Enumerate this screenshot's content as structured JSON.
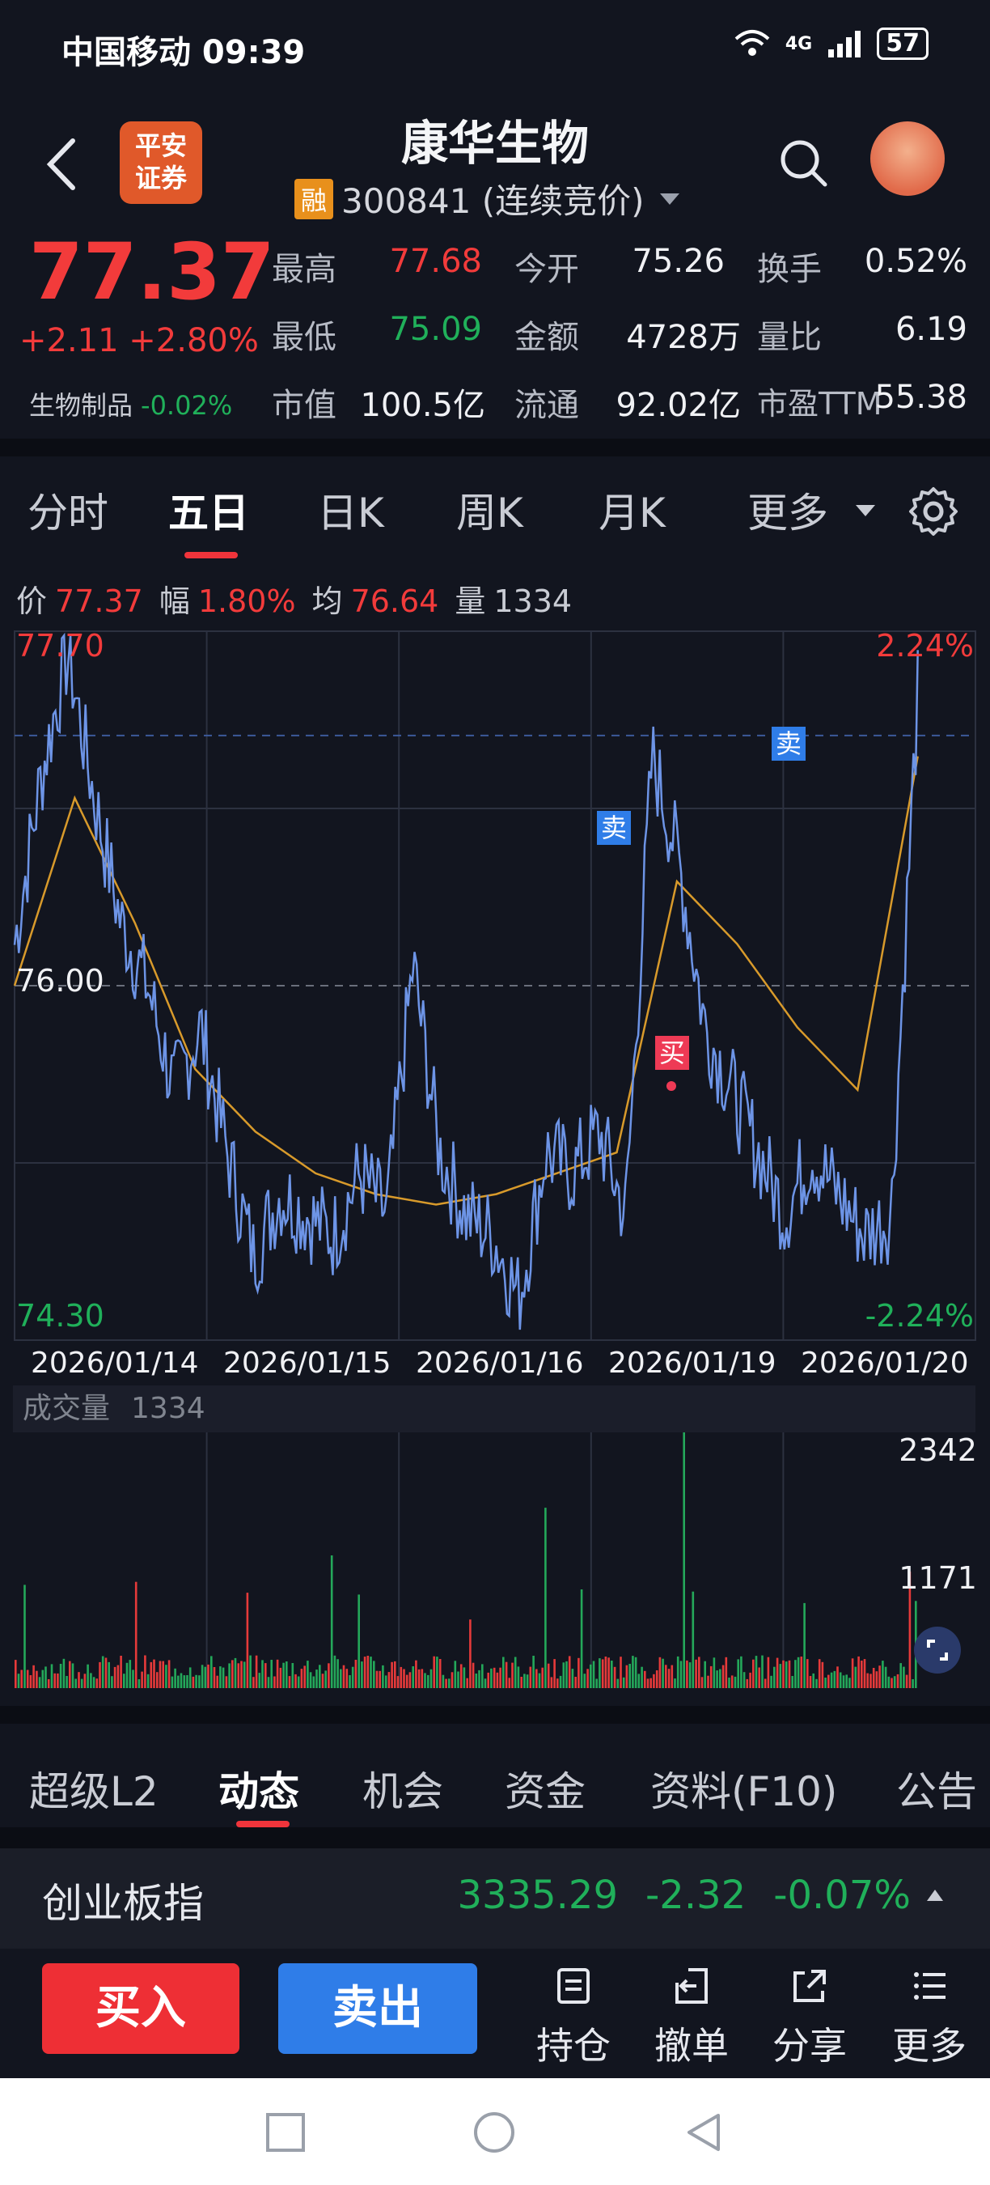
{
  "status": {
    "carrier_time": "中国移动 09:39",
    "net_badge": "4G",
    "battery": "57"
  },
  "header": {
    "logo_text": "平安\n证券",
    "name": "康华生物",
    "rong": "融",
    "code": "300841 (连续竞价)"
  },
  "quote": {
    "price": "77.37",
    "change": "+2.11  +2.80%",
    "sector_name": "生物制品",
    "sector_change": "-0.02%",
    "rows": [
      [
        {
          "l": "最高",
          "v": "77.68",
          "c": "red"
        },
        {
          "l": "今开",
          "v": "75.26",
          "c": "white"
        },
        {
          "l": "换手",
          "v": "0.52%",
          "c": "white"
        }
      ],
      [
        {
          "l": "最低",
          "v": "75.09",
          "c": "green"
        },
        {
          "l": "金额",
          "v": "4728万",
          "c": "white"
        },
        {
          "l": "量比",
          "v": "6.19",
          "c": "white"
        }
      ],
      [
        {
          "l": "市值",
          "v": "100.5亿",
          "c": "white"
        },
        {
          "l": "流通",
          "v": "92.02亿",
          "c": "white"
        },
        {
          "l": "市盈TTM",
          "v": "55.38",
          "c": "white"
        }
      ]
    ]
  },
  "tabs": [
    "分时",
    "五日",
    "日K",
    "周K",
    "月K",
    "更多"
  ],
  "info": {
    "price_label": "价",
    "price": "77.37",
    "amp_label": "幅",
    "amp": "1.80%",
    "avg_label": "均",
    "avg": "76.64",
    "vol_label": "量",
    "vol": "1334"
  },
  "chart_labels": {
    "top_price": "77.70",
    "mid_price": "76.00",
    "bottom_price": "74.30",
    "top_pct": "2.24%",
    "bottom_pct": "-2.24%",
    "sell": "卖",
    "buy": "买"
  },
  "volume": {
    "title": "成交量",
    "value": "1334",
    "max": "2342",
    "mid": "1171"
  },
  "chart_data": {
    "type": "line",
    "x": [
      "2026/01/14",
      "2026/01/15",
      "2026/01/16",
      "2026/01/19",
      "2026/01/20"
    ],
    "ylim": [
      74.3,
      77.7
    ],
    "reference": 76.0,
    "pct_range": [
      "-2.24%",
      "2.24%"
    ],
    "series": [
      {
        "values": [
          76.2,
          77.0,
          77.6,
          76.9,
          76.3,
          76.0,
          75.5,
          75.8,
          75.2,
          74.7,
          75.0,
          74.9,
          74.8,
          75.1,
          74.9,
          76.1,
          75.2,
          74.9,
          74.8,
          74.5,
          75.2,
          75.1,
          75.3,
          74.9,
          77.1,
          76.6,
          75.8,
          75.5,
          75.2,
          74.9,
          75.2,
          75.0,
          74.8,
          74.9,
          77.4
        ]
      },
      {
        "values": [
          76.0,
          76.9,
          76.3,
          75.6,
          75.3,
          75.1,
          75.0,
          74.95,
          75.0,
          75.1,
          75.2,
          76.5,
          76.2,
          75.8,
          75.5,
          77.1
        ]
      }
    ],
    "volume_ylim": [
      0,
      2342
    ],
    "volume_peaks": [
      2342,
      1631,
      1171
    ]
  },
  "tabs2": [
    "超级L2",
    "动态",
    "机会",
    "资金",
    "资料(F10)",
    "公告"
  ],
  "index": {
    "name": "创业板指",
    "value": "3335.29",
    "change": "-2.32",
    "pct": "-0.07%"
  },
  "trade": {
    "buy": "买入",
    "sell": "卖出",
    "actions": [
      "持仓",
      "撤单",
      "分享",
      "更多"
    ]
  }
}
